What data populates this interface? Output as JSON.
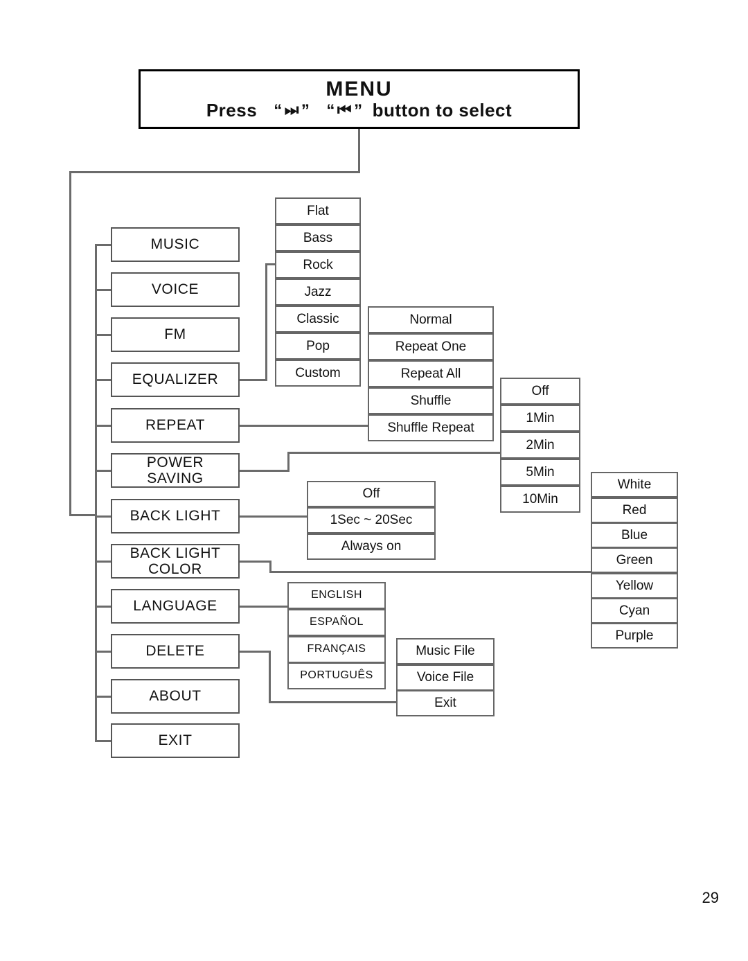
{
  "header": {
    "title": "MENU",
    "press_label": "Press",
    "quote_open": "“",
    "quote_close": "”",
    "next_icon": "next-track-icon",
    "prev_icon": "previous-track-icon",
    "next_glyph": "⏭",
    "prev_glyph": "⏮",
    "tail_label": "button to select"
  },
  "menu": {
    "items": [
      {
        "label": "MUSIC",
        "lines": [
          "MUSIC"
        ]
      },
      {
        "label": "VOICE",
        "lines": [
          "VOICE"
        ]
      },
      {
        "label": "FM",
        "lines": [
          "FM"
        ]
      },
      {
        "label": "EQUALIZER",
        "lines": [
          "EQUALIZER"
        ]
      },
      {
        "label": "REPEAT",
        "lines": [
          "REPEAT"
        ]
      },
      {
        "label": "POWER SAVING",
        "lines": [
          "POWER",
          "SAVING"
        ]
      },
      {
        "label": "BACK LIGHT",
        "lines": [
          "BACK LIGHT"
        ]
      },
      {
        "label": "BACK LIGHT COLOR",
        "lines": [
          "BACK LIGHT",
          "COLOR"
        ]
      },
      {
        "label": "LANGUAGE",
        "lines": [
          "LANGUAGE"
        ]
      },
      {
        "label": "DELETE",
        "lines": [
          "DELETE"
        ]
      },
      {
        "label": "ABOUT",
        "lines": [
          "ABOUT"
        ]
      },
      {
        "label": "EXIT",
        "lines": [
          "EXIT"
        ]
      }
    ]
  },
  "submenus": {
    "equalizer": {
      "parent": "EQUALIZER",
      "options": [
        "Flat",
        "Bass",
        "Rock",
        "Jazz",
        "Classic",
        "Pop",
        "Custom"
      ]
    },
    "repeat": {
      "parent": "REPEAT",
      "options": [
        "Normal",
        "Repeat One",
        "Repeat All",
        "Shuffle",
        "Shuffle Repeat"
      ]
    },
    "power_saving": {
      "parent": "POWER SAVING",
      "options": [
        "Off",
        "1Min",
        "2Min",
        "5Min",
        "10Min"
      ]
    },
    "back_light": {
      "parent": "BACK LIGHT",
      "options": [
        "Off",
        "1Sec ~ 20Sec",
        "Always on"
      ]
    },
    "back_light_color": {
      "parent": "BACK LIGHT COLOR",
      "options": [
        "White",
        "Red",
        "Blue",
        "Green",
        "Yellow",
        "Cyan",
        "Purple"
      ]
    },
    "language": {
      "parent": "LANGUAGE",
      "options": [
        "ENGLISH",
        "ESPAÑOL",
        "FRANÇAIS",
        "PORTUGUÊS"
      ]
    },
    "delete": {
      "parent": "DELETE",
      "options": [
        "Music File",
        "Voice File",
        "Exit"
      ]
    }
  },
  "footer": {
    "page_number": "29"
  },
  "colors": {
    "line": "#6b6b6b",
    "box_border": "#555555",
    "text": "#111111",
    "background": "#ffffff"
  }
}
